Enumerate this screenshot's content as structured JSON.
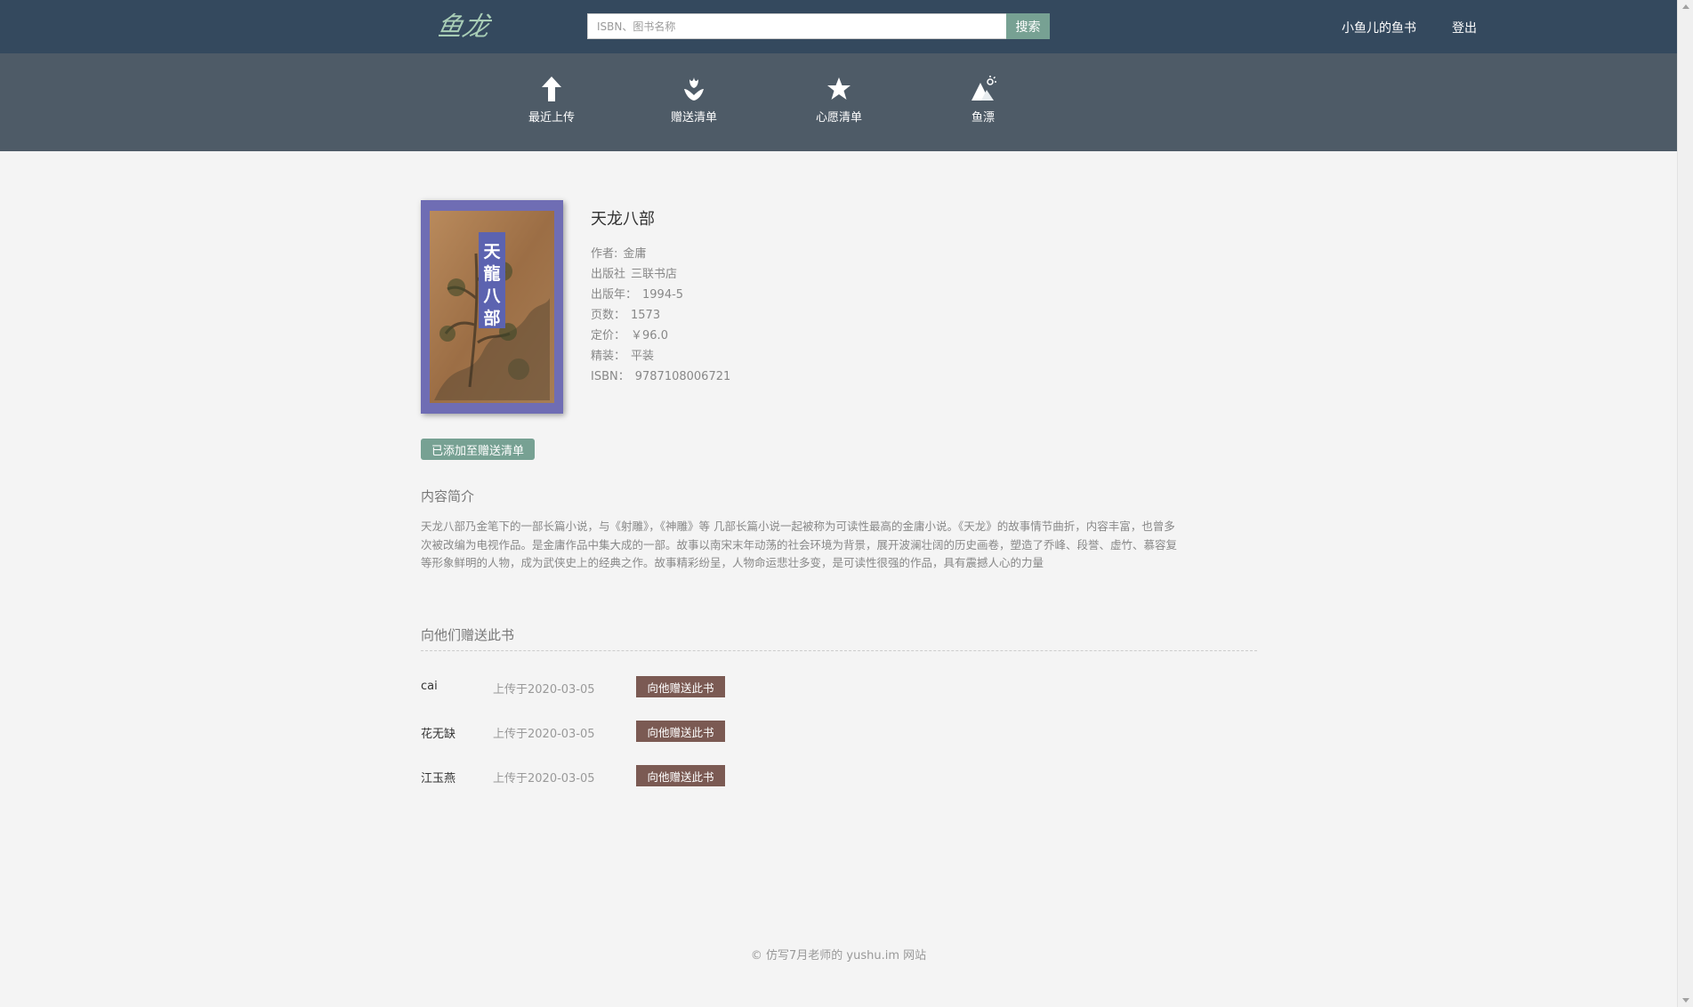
{
  "header": {
    "logo_text": "鱼龙",
    "search": {
      "placeholder": "ISBN、图书名称",
      "value": "",
      "button_label": "搜索"
    },
    "user_link": "小鱼儿的鱼书",
    "logout_link": "登出"
  },
  "menu": {
    "items": [
      {
        "label": "最近上传",
        "icon": "upload-arrow-icon"
      },
      {
        "label": "赠送清单",
        "icon": "gift-flower-icon"
      },
      {
        "label": "心愿清单",
        "icon": "star-icon"
      },
      {
        "label": "鱼漂",
        "icon": "mountain-icon"
      }
    ]
  },
  "book": {
    "cover_text": "天龍八部",
    "title": "天龙八部",
    "meta": [
      {
        "label": "作者:",
        "value": "金庸"
      },
      {
        "label": "出版社",
        "value": "三联书店"
      },
      {
        "label": "出版年：",
        "value": "1994-5"
      },
      {
        "label": "页数：",
        "value": "1573"
      },
      {
        "label": "定价：",
        "value": "￥96.0"
      },
      {
        "label": "精装：",
        "value": "平装"
      },
      {
        "label": "ISBN：",
        "value": "9787108006721"
      }
    ],
    "added_label": "已添加至赠送清单",
    "summary_heading": "内容简介",
    "summary": "天龙八部乃金笔下的一部长篇小说，与《射雕》，《神雕》等 几部长篇小说一起被称为可读性最高的金庸小说。《天龙》的故事情节曲折，内容丰富，也曾多次被改编为电视作品。是金庸作品中集大成的一部。故事以南宋末年动荡的社会环境为背景，展开波澜壮阔的历史画卷，塑造了乔峰、段誉、虚竹、慕容复等形象鲜明的人物，成为武侠史上的经典之作。故事精彩纷呈，人物命运悲壮多变，是可读性很强的作品，具有震撼人心的力量"
  },
  "givers": {
    "heading": "向他们赠送此书",
    "rows": [
      {
        "name": "cai",
        "date": "上传于2020-03-05",
        "button": "向他赠送此书"
      },
      {
        "name": "花无缺",
        "date": "上传于2020-03-05",
        "button": "向他赠送此书"
      },
      {
        "name": "江玉燕",
        "date": "上传于2020-03-05",
        "button": "向他赠送此书"
      }
    ]
  },
  "footer": {
    "text": "© 仿写7月老师的 yushu.im 网站"
  },
  "colors": {
    "topbar": "#34495e",
    "menubar": "#4e5b67",
    "accent": "#77a193",
    "gift_button": "#7b5a53",
    "background": "#f4f4f4"
  }
}
